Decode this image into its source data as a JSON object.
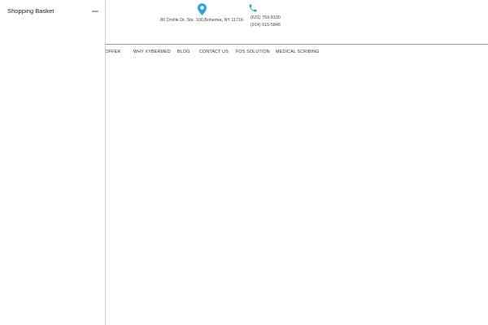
{
  "header": {
    "address": "80 Orville Dr. Ste. 100,Bohemia, NY 11716",
    "phone_primary": "(631) 759-8100",
    "phone_secondary": "(914) 515-5846",
    "accent_color": "#29a8e0",
    "icons": {
      "address": "map-pin-icon",
      "phone": "phone-icon"
    }
  },
  "nav": {
    "items": [
      {
        "label": "E OFFER"
      },
      {
        "label": "WHY XYBERMED"
      },
      {
        "label": "BLOG"
      },
      {
        "label": "CONTACT US"
      },
      {
        "label": "FOS SOLUTION"
      },
      {
        "label": "MEDICAL SCRIBING"
      }
    ]
  },
  "drawer": {
    "title": "Shopping Basket",
    "close_icon": "minus-icon"
  }
}
